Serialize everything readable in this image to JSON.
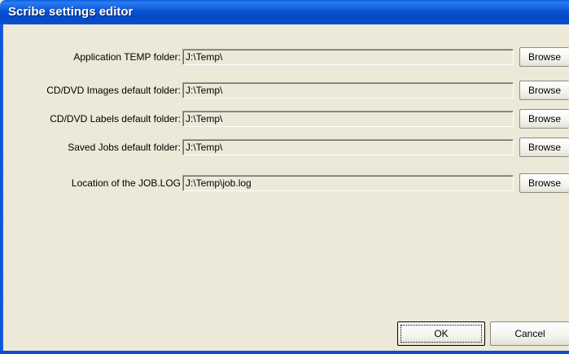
{
  "window": {
    "title": "Scribe settings editor"
  },
  "settings": [
    {
      "label": "Application TEMP folder:",
      "value": "J:\\Temp\\",
      "browse_label": "Browse"
    },
    {
      "label": "CD/DVD Images default folder:",
      "value": "J:\\Temp\\",
      "browse_label": "Browse"
    },
    {
      "label": "CD/DVD Labels default folder:",
      "value": "J:\\Temp\\",
      "browse_label": "Browse"
    },
    {
      "label": "Saved Jobs default folder:",
      "value": "J:\\Temp\\",
      "browse_label": "Browse"
    },
    {
      "label": "Location of the JOB.LOG",
      "value": "J:\\Temp\\job.log",
      "browse_label": "Browse"
    }
  ],
  "footer": {
    "ok_label": "OK",
    "cancel_label": "Cancel"
  }
}
